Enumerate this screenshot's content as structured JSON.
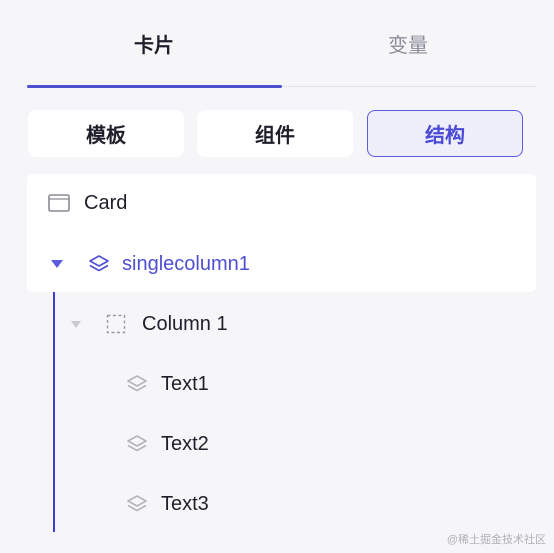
{
  "tabs": [
    {
      "label": "卡片",
      "active": true
    },
    {
      "label": "变量",
      "active": false
    }
  ],
  "segments": [
    {
      "label": "模板",
      "selected": false
    },
    {
      "label": "组件",
      "selected": false
    },
    {
      "label": "结构",
      "selected": true
    }
  ],
  "tree": {
    "root": {
      "label": "Card",
      "icon": "card-icon"
    },
    "container": {
      "label": "singlecolumn1",
      "icon": "layers-icon",
      "expanded": true,
      "selected": true
    },
    "column": {
      "label": "Column 1",
      "icon": "dashed-square-icon",
      "expanded": true
    },
    "items": [
      {
        "label": "Text1",
        "icon": "layers-icon"
      },
      {
        "label": "Text2",
        "icon": "layers-icon"
      },
      {
        "label": "Text3",
        "icon": "layers-icon"
      }
    ]
  },
  "colors": {
    "accent": "#4f4fd1",
    "background": "#f6f6f9"
  },
  "watermark": "@稀土掘金技术社区"
}
